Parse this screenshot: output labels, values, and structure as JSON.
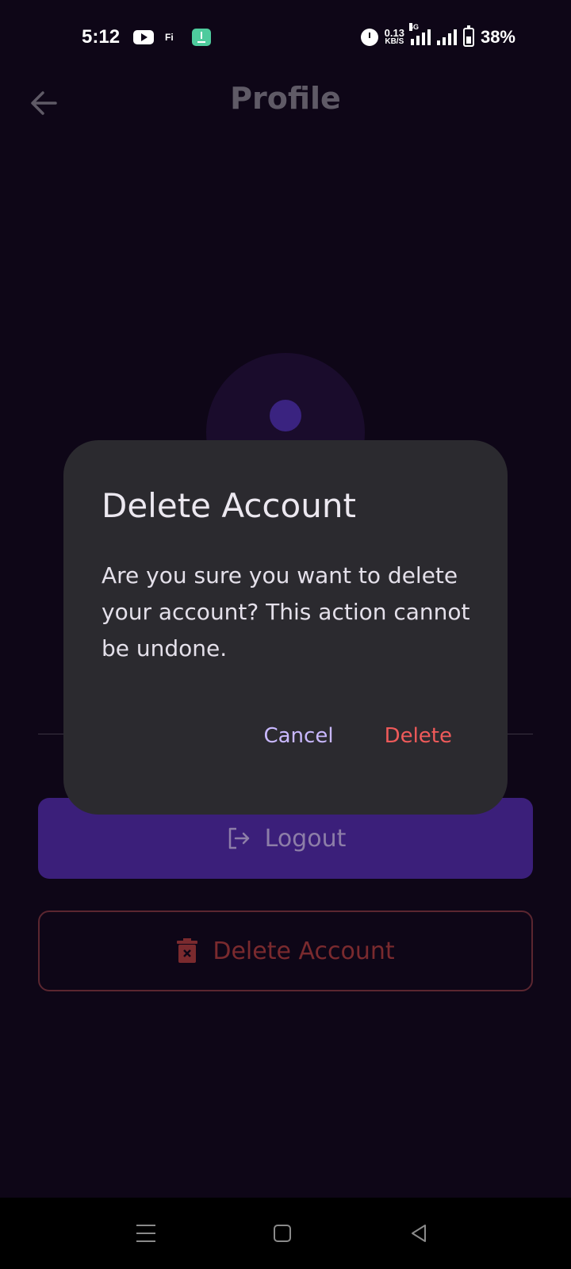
{
  "status_bar": {
    "time": "5:12",
    "fi_label": "Fi",
    "net_speed_value": "0.13",
    "net_speed_unit": "KB/S",
    "network_type": "4G",
    "battery": "38%"
  },
  "header": {
    "title": "Profile",
    "back_icon": "arrow-left-icon"
  },
  "actions": {
    "logout_label": "Logout",
    "delete_account_label": "Delete Account"
  },
  "dialog": {
    "title": "Delete Account",
    "message": "Are you sure you want to delete your account? This action cannot be undone.",
    "cancel_label": "Cancel",
    "delete_label": "Delete"
  },
  "colors": {
    "background": "#0e0617",
    "accent": "#3b1f7a",
    "danger": "#ef5a5a",
    "dialog_bg": "#2b2a2f",
    "cancel": "#c9b8ff"
  }
}
